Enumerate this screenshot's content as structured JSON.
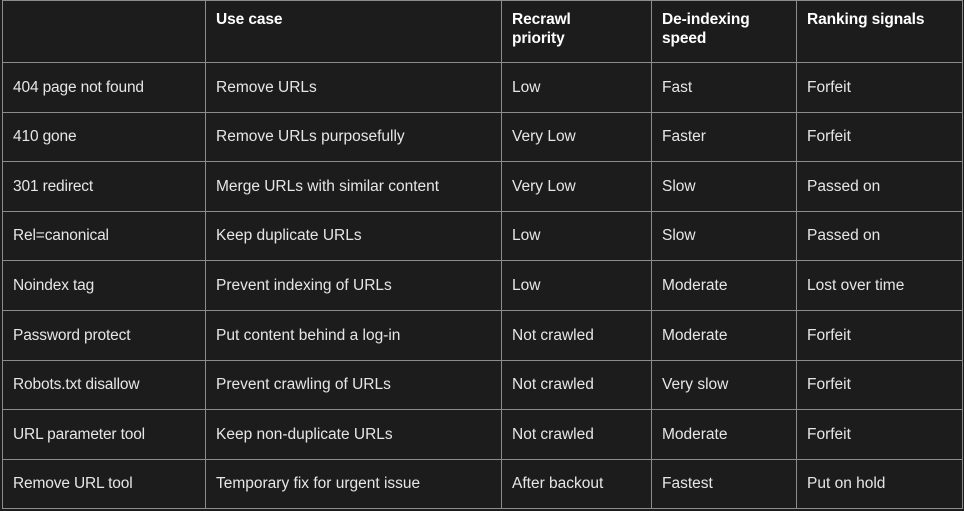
{
  "table": {
    "corner_label": "",
    "colors": {
      "background": "#1c1c1c",
      "border": "#8c8c8c",
      "header_text": "#ffffff",
      "body_text": "#d6d6d6",
      "yellow": "#f2ea4c",
      "green": "#3ad62e",
      "red": "#e8332b",
      "corner_cell": "#ffffff"
    },
    "columns": [
      {
        "id": "method",
        "label": ""
      },
      {
        "id": "use_case",
        "label": "Use case",
        "lines": [
          "Use case"
        ]
      },
      {
        "id": "recrawl_priority",
        "label": "Recrawl priority",
        "lines": [
          "Recrawl",
          "priority"
        ]
      },
      {
        "id": "deindexing_speed",
        "label": "De-indexing speed",
        "lines": [
          "De-indexing",
          "speed"
        ]
      },
      {
        "id": "ranking_signals",
        "label": "Ranking signals",
        "lines": [
          "Ranking signals"
        ]
      }
    ],
    "rows": [
      {
        "method": "404 page not found",
        "use_case": "Remove URLs",
        "recrawl_priority": {
          "text": "Low",
          "color": "yellow"
        },
        "deindexing_speed": {
          "text": "Fast",
          "color": "green"
        },
        "ranking_signals": {
          "text": "Forfeit",
          "color": "red"
        }
      },
      {
        "method": "410 gone",
        "use_case": "Remove URLs purposefully",
        "recrawl_priority": {
          "text": "Very Low",
          "color": "yellow"
        },
        "deindexing_speed": {
          "text": "Faster",
          "color": "green"
        },
        "ranking_signals": {
          "text": "Forfeit",
          "color": "red"
        }
      },
      {
        "method": "301 redirect",
        "use_case": "Merge URLs with similar content",
        "recrawl_priority": {
          "text": "Very Low",
          "color": "yellow"
        },
        "deindexing_speed": {
          "text": "Slow",
          "color": "yellow"
        },
        "ranking_signals": {
          "text": "Passed on",
          "color": "green"
        }
      },
      {
        "method": "Rel=canonical",
        "use_case": "Keep duplicate URLs",
        "recrawl_priority": {
          "text": "Low",
          "color": "yellow"
        },
        "deindexing_speed": {
          "text": "Slow",
          "color": "yellow"
        },
        "ranking_signals": {
          "text": "Passed on",
          "color": "green"
        }
      },
      {
        "method": "Noindex tag",
        "use_case": "Prevent indexing of URLs",
        "recrawl_priority": {
          "text": "Low",
          "color": "yellow"
        },
        "deindexing_speed": {
          "text": "Moderate",
          "color": "yellow"
        },
        "ranking_signals": {
          "text": "Lost over time",
          "color": "red"
        }
      },
      {
        "method": "Password protect",
        "use_case": "Put content behind a log-in",
        "recrawl_priority": {
          "text": "Not crawled",
          "color": "green"
        },
        "deindexing_speed": {
          "text": "Moderate",
          "color": "yellow"
        },
        "ranking_signals": {
          "text": "Forfeit",
          "color": "red"
        }
      },
      {
        "method": "Robots.txt disallow",
        "use_case": "Prevent crawling of URLs",
        "recrawl_priority": {
          "text": "Not crawled",
          "color": "green"
        },
        "deindexing_speed": {
          "text": "Very slow",
          "color": "red"
        },
        "ranking_signals": {
          "text": "Forfeit",
          "color": "red"
        }
      },
      {
        "method": "URL parameter tool",
        "use_case": "Keep non-duplicate URLs",
        "recrawl_priority": {
          "text": "Not crawled",
          "color": "green"
        },
        "deindexing_speed": {
          "text": "Moderate",
          "color": "yellow"
        },
        "ranking_signals": {
          "text": "Forfeit",
          "color": "red"
        }
      },
      {
        "method": "Remove URL tool",
        "use_case": "Temporary fix for urgent issue",
        "recrawl_priority": {
          "text": "After backout",
          "color": "red"
        },
        "deindexing_speed": {
          "text": "Fastest",
          "color": "green"
        },
        "ranking_signals": {
          "text": "Put on hold",
          "color": "yellow"
        }
      }
    ]
  }
}
